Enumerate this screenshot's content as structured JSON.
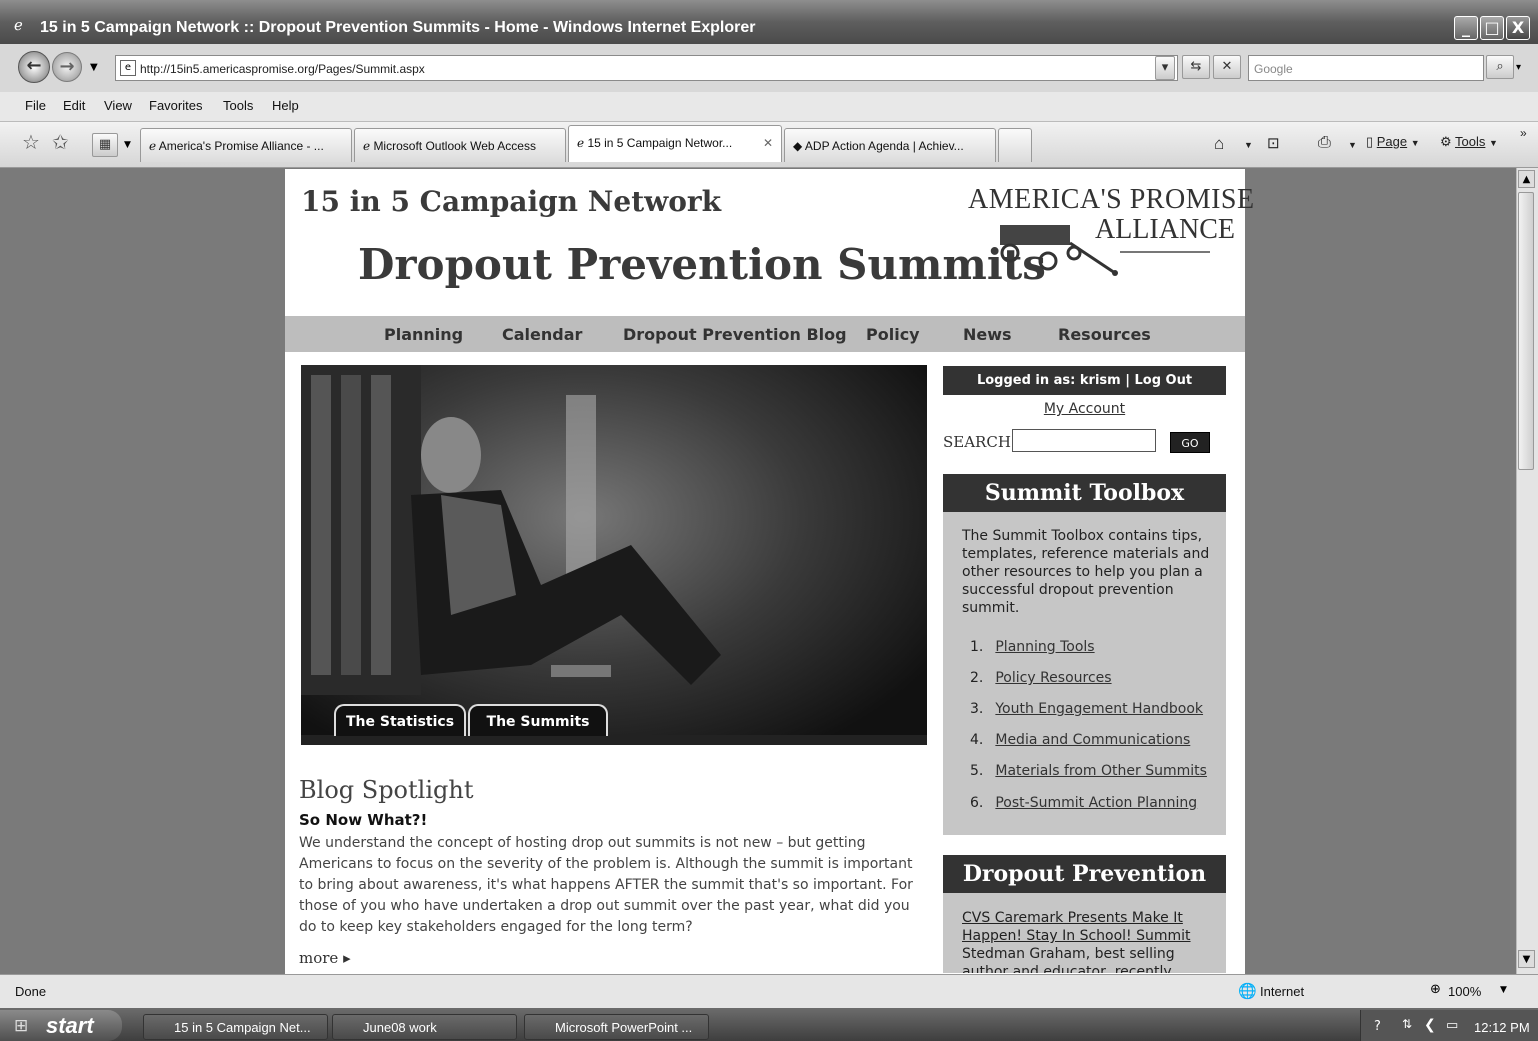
{
  "window": {
    "title": "15 in 5 Campaign Network :: Dropout Prevention Summits - Home - Windows Internet Explorer",
    "controls": [
      "_",
      "□",
      "X"
    ]
  },
  "address": {
    "url": "http://15in5.americaspromise.org/Pages/Summit.aspx",
    "search_placeholder": "Google"
  },
  "menu": [
    "File",
    "Edit",
    "View",
    "Favorites",
    "Tools",
    "Help"
  ],
  "tabs": [
    {
      "label": "America's Promise Alliance - ...",
      "active": false
    },
    {
      "label": "Microsoft Outlook Web Access",
      "active": false
    },
    {
      "label": "15 in 5 Campaign Networ...",
      "active": true
    },
    {
      "label": "ADP Action Agenda | Achiev...",
      "active": false
    }
  ],
  "toolbar": {
    "page_label": "Page",
    "tools_label": "Tools"
  },
  "site": {
    "network_title": "15 in 5 Campaign Network",
    "summits_title": "Dropout Prevention Summits",
    "logo_line1": "AMERICA'S PROMISE",
    "logo_line2": "ALLIANCE",
    "nav": [
      "Planning",
      "Calendar",
      "Dropout Prevention Blog",
      "Policy",
      "News",
      "Resources"
    ],
    "hero_tabs": [
      "The Statistics",
      "The Summits"
    ],
    "blog": {
      "heading": "Blog Spotlight",
      "post_title": "So Now What?!",
      "text": "We understand the concept of hosting drop out summits is not new – but getting Americans to focus on the severity of the problem is. Although the summit is important to bring about awareness, it's what happens AFTER the summit that's so important. For those of you who have undertaken a drop out summit over the past year, what did you do to keep key stakeholders engaged for the long term?",
      "more": "more ▸"
    },
    "login": "Logged in as: krism | Log Out",
    "my_account": "My Account",
    "search_label": "SEARCH:",
    "go": "GO",
    "toolbox": {
      "heading": "Summit Toolbox",
      "text": "The Summit Toolbox contains tips, templates, reference materials and other resources to help you plan a successful dropout prevention summit.",
      "items": [
        "Planning Tools",
        "Policy Resources",
        "Youth Engagement Handbook",
        "Media and Communications",
        "Materials from Other Summits",
        "Post-Summit Action Planning"
      ],
      "numbers": [
        "1.",
        "2.",
        "3.",
        "4.",
        "5.",
        "6."
      ]
    },
    "news": {
      "heading": "Dropout Prevention News",
      "link": "CVS Caremark Presents Make It Happen! Stay In School! Summit",
      "text": "Stedman Graham, best selling author and educator, recently spoke to"
    }
  },
  "status": {
    "text": "Done",
    "zone": "Internet",
    "zoom": "100%"
  },
  "taskbar": {
    "start": "start",
    "items": [
      "15 in 5 Campaign Net...",
      "June08 work",
      "Microsoft PowerPoint ..."
    ],
    "clock": "12:12 PM"
  }
}
